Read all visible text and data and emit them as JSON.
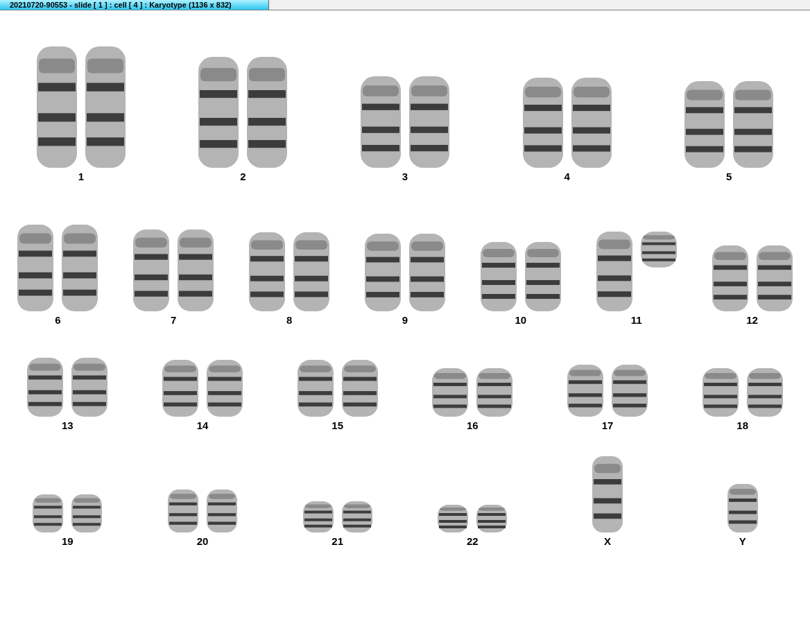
{
  "window": {
    "title": "20210720-90553 - slide [ 1 ] : cell [ 4 ] : Karyotype  (1136 x 832)"
  },
  "karyotype": {
    "rows": [
      {
        "chromosomes": [
          {
            "label": "1",
            "kind": "pair"
          },
          {
            "label": "2",
            "kind": "pair"
          },
          {
            "label": "3",
            "kind": "pair"
          },
          {
            "label": "4",
            "kind": "pair"
          },
          {
            "label": "5",
            "kind": "pair"
          }
        ]
      },
      {
        "chromosomes": [
          {
            "label": "6",
            "kind": "pair"
          },
          {
            "label": "7",
            "kind": "pair"
          },
          {
            "label": "8",
            "kind": "pair"
          },
          {
            "label": "9",
            "kind": "pair"
          },
          {
            "label": "10",
            "kind": "pair"
          },
          {
            "label": "11",
            "kind": "unequal"
          },
          {
            "label": "12",
            "kind": "pair"
          }
        ]
      },
      {
        "chromosomes": [
          {
            "label": "13",
            "kind": "pair"
          },
          {
            "label": "14",
            "kind": "pair"
          },
          {
            "label": "15",
            "kind": "pair"
          },
          {
            "label": "16",
            "kind": "pair"
          },
          {
            "label": "17",
            "kind": "pair"
          },
          {
            "label": "18",
            "kind": "pair"
          }
        ]
      },
      {
        "chromosomes": [
          {
            "label": "19",
            "kind": "pair"
          },
          {
            "label": "20",
            "kind": "pair"
          },
          {
            "label": "21",
            "kind": "pair"
          },
          {
            "label": "22",
            "kind": "pair"
          },
          {
            "label": "X",
            "kind": "single"
          },
          {
            "label": "Y",
            "kind": "single"
          }
        ]
      }
    ]
  }
}
